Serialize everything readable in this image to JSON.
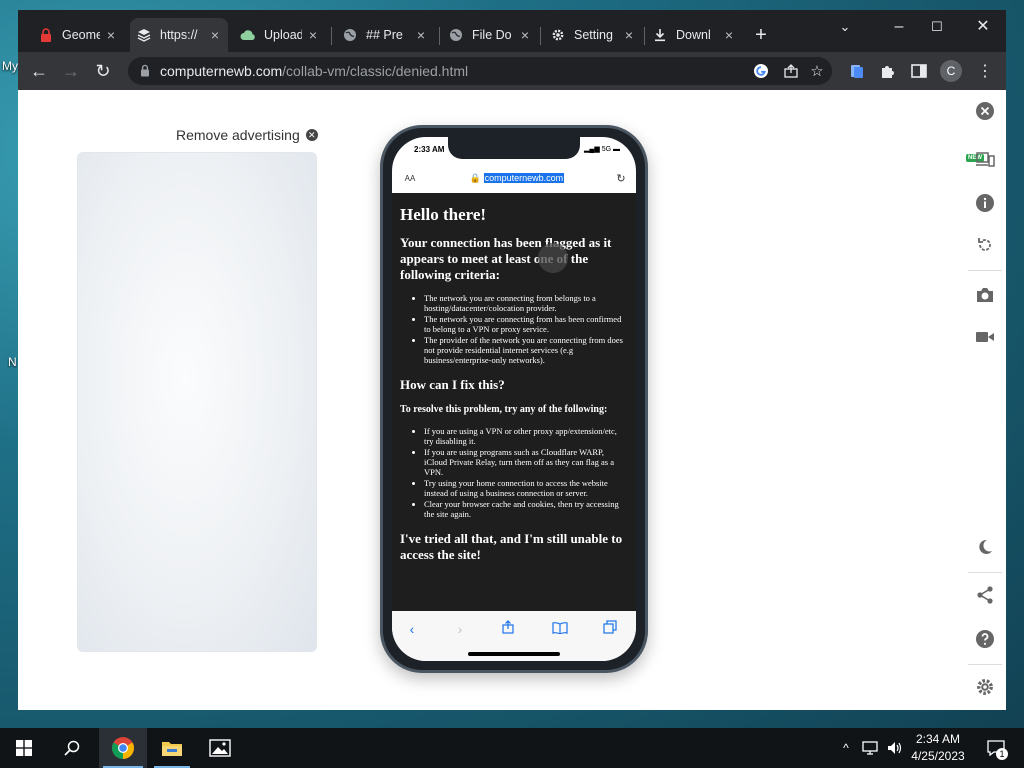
{
  "desktop": {
    "labels": [
      "My",
      "N"
    ]
  },
  "browser": {
    "tabs": [
      {
        "label": "Geome",
        "icon": "lock-red-icon"
      },
      {
        "label": "https://",
        "icon": "vm-icon"
      },
      {
        "label": "Upload",
        "icon": "cloud-icon"
      },
      {
        "label": "## Pre",
        "icon": "globe-icon"
      },
      {
        "label": "File Do",
        "icon": "globe-icon"
      },
      {
        "label": "Setting",
        "icon": "gear-icon"
      },
      {
        "label": "Downl",
        "icon": "download-icon"
      }
    ],
    "active_tab_index": 1,
    "address": {
      "domain": "computernewb.com",
      "path": "/collab-vm/classic/denied.html"
    },
    "profile_initial": "C"
  },
  "page": {
    "remove_advertising": "Remove advertising",
    "phone": {
      "status_time": "2:33 AM",
      "status_signal": "5G",
      "address_aa": "AA",
      "address_domain": "computernewb.com",
      "heading": "Hello there!",
      "subheading": "Your connection has been flagged as it appears to meet at least one of the following criteria:",
      "criteria": [
        "The network you are connecting from belongs to a hosting/datacenter/colocation provider.",
        "The network you are connecting from has been confirmed to belong to a VPN or proxy service.",
        "The provider of the network you are connecting from does not provide residential internet services (e.g business/enterprise-only networks)."
      ],
      "fix_heading": "How can I fix this?",
      "fix_intro": "To resolve this problem, try any of the following:",
      "fixes": [
        "If you are using a VPN or other proxy app/extension/etc, try disabling it.",
        "If you are using programs such as Cloudflare WARP, iCloud Private Relay, turn them off as they can flag as a VPN.",
        "Try using your home connection to access the website instead of using a business connection or server.",
        "Clear your browser cache and cookies, then try accessing the site again."
      ],
      "tried_heading": "I've tried all that, and I'm still unable to access the site!"
    },
    "rail": {
      "new_badge": "NEW"
    }
  },
  "taskbar": {
    "time": "2:34 AM",
    "date": "4/25/2023",
    "notification_count": "1"
  },
  "colors": {
    "tab_strip": "#202124",
    "toolbar": "#35363a",
    "phone_content_bg": "#1e1e1e",
    "selection_blue": "#1a73e8"
  }
}
